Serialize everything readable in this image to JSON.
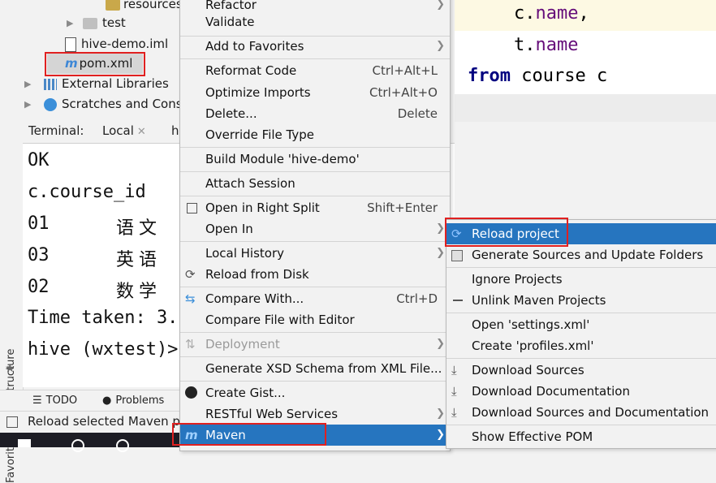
{
  "project_tree": {
    "items": [
      {
        "label": "resources",
        "icon": "folder-icon"
      },
      {
        "label": "test",
        "icon": "folder-icon"
      },
      {
        "label": "hive-demo.iml",
        "icon": "module-file-icon"
      },
      {
        "label": "pom.xml",
        "icon": "maven-icon"
      },
      {
        "label": "External Libraries",
        "icon": "library-icon"
      },
      {
        "label": "Scratches and Conso",
        "icon": "scratches-icon"
      }
    ]
  },
  "editor": {
    "lines": [
      "c.",
      "name",
      ",",
      "t.",
      "name",
      "from",
      " course c"
    ]
  },
  "terminal": {
    "label": "Terminal:",
    "tabs": [
      "Local",
      "h"
    ],
    "lines": [
      "OK",
      "c.course_id",
      "01",
      "语文",
      "03",
      "英语",
      "02",
      "数学",
      "Time taken: 3.",
      "hive (wxtest)>"
    ]
  },
  "left_strip": {
    "structure": "Structure",
    "favorites": "Favorites"
  },
  "toolwindow_bar": {
    "todo": "TODO",
    "problems": "Problems"
  },
  "status_bar": {
    "text": "Reload selected Maven p"
  },
  "context_menu": {
    "items": [
      {
        "label": "Refactor",
        "submenu": true
      },
      {
        "label": "Validate"
      },
      {
        "label": "Add to Favorites",
        "submenu": true
      },
      {
        "label": "Reformat Code",
        "shortcut": "Ctrl+Alt+L"
      },
      {
        "label": "Optimize Imports",
        "shortcut": "Ctrl+Alt+O"
      },
      {
        "label": "Delete...",
        "shortcut": "Delete"
      },
      {
        "label": "Override File Type"
      },
      {
        "label": "Build Module 'hive-demo'"
      },
      {
        "label": "Attach Session"
      },
      {
        "label": "Open in Right Split",
        "shortcut": "Shift+Enter"
      },
      {
        "label": "Open In",
        "submenu": true
      },
      {
        "label": "Local History",
        "submenu": true
      },
      {
        "label": "Reload from Disk"
      },
      {
        "label": "Compare With...",
        "shortcut": "Ctrl+D"
      },
      {
        "label": "Compare File with Editor"
      },
      {
        "label": "Deployment",
        "submenu": true,
        "disabled": true
      },
      {
        "label": "Generate XSD Schema from XML File..."
      },
      {
        "label": "Create Gist..."
      },
      {
        "label": "RESTful Web Services",
        "submenu": true
      },
      {
        "label": "Maven",
        "submenu": true,
        "selected": true
      }
    ]
  },
  "maven_submenu": {
    "items": [
      {
        "label": "Reload project",
        "selected": true
      },
      {
        "label": "Generate Sources and Update Folders"
      },
      {
        "label": "Ignore Projects"
      },
      {
        "label": "Unlink Maven Projects"
      },
      {
        "label": "Open 'settings.xml'"
      },
      {
        "label": "Create 'profiles.xml'"
      },
      {
        "label": "Download Sources"
      },
      {
        "label": "Download Documentation"
      },
      {
        "label": "Download Sources and Documentation"
      },
      {
        "label": "Show Effective POM"
      }
    ]
  },
  "colors": {
    "selection": "#2675bf",
    "annotation_box": "#e02020",
    "keyword": "#000080",
    "field": "#660e7a"
  }
}
